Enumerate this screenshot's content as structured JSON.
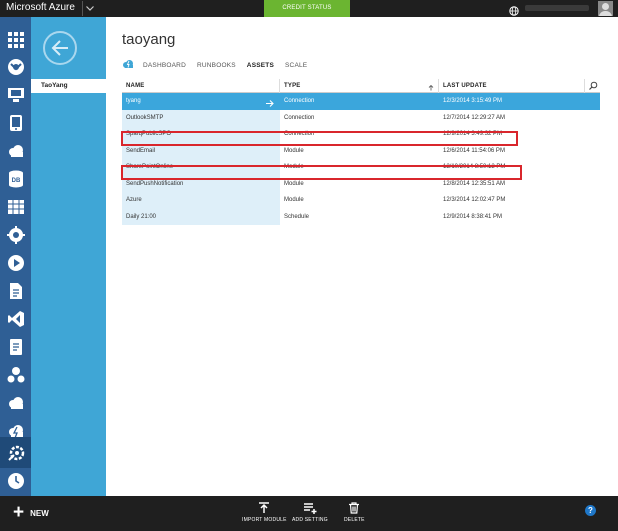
{
  "topbar": {
    "brand": "Microsoft Azure",
    "credit_label": "CREDIT STATUS",
    "credit_color": "#6bb531"
  },
  "sidebar": {
    "icons": [
      "all-items-icon",
      "web-sites-icon",
      "virtual-machines-icon",
      "mobile-services-icon",
      "cloud-services-icon",
      "sql-databases-icon",
      "storage-icon",
      "hdinsight-icon",
      "media-services-icon",
      "service-bus-icon",
      "visual-studio-icon",
      "cache-icon",
      "biztalk-icon",
      "recovery-services-icon",
      "cdn-icon",
      "automation-icon",
      "scheduler-icon",
      "api-management-icon"
    ],
    "active_icon": "automation-icon"
  },
  "secondary_nav": {
    "selected_item": "TaoYang"
  },
  "page": {
    "title": "taoyang",
    "tabs": [
      {
        "label": "DASHBOARD",
        "active": false
      },
      {
        "label": "RUNBOOKS",
        "active": false
      },
      {
        "label": "ASSETS",
        "active": true
      },
      {
        "label": "SCALE",
        "active": false
      }
    ]
  },
  "grid": {
    "columns": [
      "NAME",
      "TYPE",
      "LAST UPDATE"
    ],
    "sort_column": "TYPE",
    "rows": [
      {
        "name": "tyang",
        "type": "Connection",
        "updated": "12/3/2014 3:15:49 PM",
        "selected": true
      },
      {
        "name": "OutlookSMTP",
        "type": "Connection",
        "updated": "12/7/2014 12:29:27 AM"
      },
      {
        "name": "SparqPublicSPO",
        "type": "Connection",
        "updated": "12/9/2014 3:49:32 PM",
        "highlighted": true
      },
      {
        "name": "SendEmail",
        "type": "Module",
        "updated": "12/6/2014 11:54:06 PM"
      },
      {
        "name": "SharePointOnline",
        "type": "Module",
        "updated": "12/10/2014 8:50:12 PM",
        "highlighted": true
      },
      {
        "name": "SendPushNotification",
        "type": "Module",
        "updated": "12/8/2014 12:35:51 AM"
      },
      {
        "name": "Azure",
        "type": "Module",
        "updated": "12/3/2014 12:02:47 PM"
      },
      {
        "name": "Daily 21:00",
        "type": "Schedule",
        "updated": "12/9/2014 8:38:41 PM"
      }
    ],
    "highlight_color": "#d9262c",
    "selected_color": "#3ba6dc"
  },
  "bottombar": {
    "new_label": "NEW",
    "commands": [
      {
        "label": "IMPORT MODULE",
        "icon": "import-icon"
      },
      {
        "label": "ADD SETTING",
        "icon": "add-setting-icon"
      },
      {
        "label": "DELETE",
        "icon": "trash-icon"
      }
    ],
    "help_label": "?"
  }
}
